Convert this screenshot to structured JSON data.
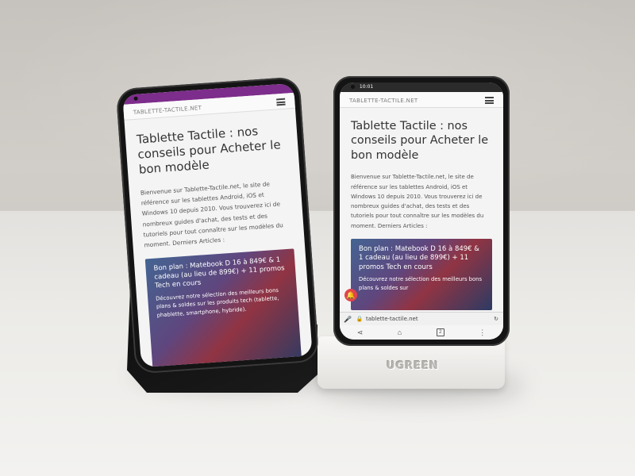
{
  "brand_label": "UGREEN",
  "left_phone": {
    "site_logo": "TABLETTE-TACTILE.NET",
    "headline": "Tablette Tactile : nos conseils pour Acheter le bon modèle",
    "intro": "Bienvenue sur Tablette-Tactile.net, le site de référence sur les tablettes Android, iOS et Windows 10 depuis 2010. Vous trouverez ici de nombreux guides d'achat, des tests et des tutoriels pour tout connaître sur les modèles du moment. Derniers Articles :",
    "card_title": "Bon plan : Matebook D 16 à 849€ & 1 cadeau (au lieu de 899€) + 11 promos Tech en cours",
    "card_text": "Découvrez notre sélection des meilleurs bons plans & soldes sur les produits tech (tablette, phablette, smartphone, hybride)."
  },
  "right_phone": {
    "status_time": "10:01",
    "site_logo": "TABLETTE-TACTILE.NET",
    "headline": "Tablette Tactile : nos conseils pour Acheter le bon modèle",
    "intro": "Bienvenue sur Tablette-Tactile.net, le site de référence sur les tablettes Android, iOS et Windows 10 depuis 2010. Vous trouverez ici de nombreux guides d'achat, des tests et des tutoriels pour tout connaître sur les modèles du moment. Derniers Articles :",
    "card_title": "Bon plan : Matebook D 16 à 849€ & 1 cadeau (au lieu de 899€) + 11 promos Tech en cours",
    "card_text": "Découvrez notre sélection des meilleurs bons plans & soldes sur",
    "url": "tablette-tactile.net",
    "tab_count": "2"
  },
  "colors": {
    "left_statusbar": "#7d2d8b",
    "card_accent": "#c1465a",
    "notification_bell": "#e0454a"
  },
  "icons": [
    "menu-icon",
    "bell-icon",
    "mic-icon",
    "lock-icon",
    "reload-icon",
    "share-icon",
    "home-icon",
    "tabs-icon",
    "more-icon"
  ]
}
